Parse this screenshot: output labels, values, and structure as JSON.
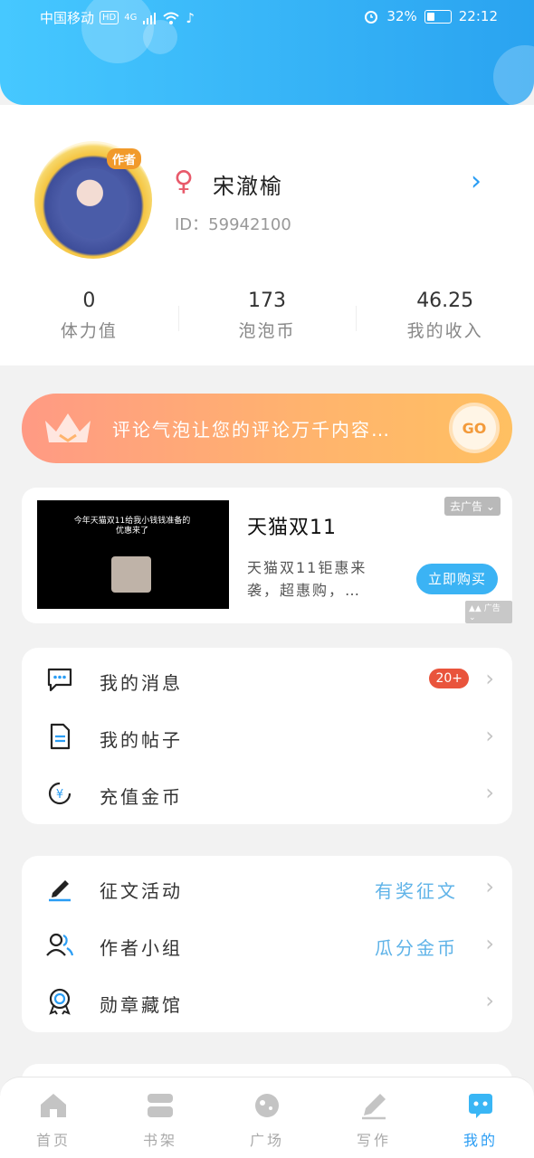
{
  "status_bar": {
    "carrier": "中国移动",
    "hd": "HD",
    "network": "4G",
    "battery_percent": "32%",
    "battery_level": 0.32,
    "time": "22:12"
  },
  "profile": {
    "author_tag": "作者",
    "username": "宋澈榆",
    "user_id": "ID：59942100",
    "stats": [
      {
        "value": "0",
        "label": "体力值"
      },
      {
        "value": "173",
        "label": "泡泡币"
      },
      {
        "value": "46.25",
        "label": "我的收入"
      }
    ]
  },
  "promo": {
    "text": "评论气泡让您的评论万千内容…",
    "button": "GO"
  },
  "ad": {
    "image_caption": "今年天猫双11给我小钱钱准备的优惠来了",
    "title": "天猫双11",
    "description": "天猫双11钜惠来袭，超惠购，…",
    "close_label": "去广告",
    "buy_label": "立即购买",
    "ad_label": "广告"
  },
  "menu_group_1": [
    {
      "label": "我的消息",
      "badge": "20+"
    },
    {
      "label": "我的帖子"
    },
    {
      "label": "充值金币"
    }
  ],
  "menu_group_2": [
    {
      "label": "征文活动",
      "extra": "有奖征文"
    },
    {
      "label": "作者小组",
      "extra": "瓜分金币"
    },
    {
      "label": "勋章藏馆"
    }
  ],
  "bottom_nav": [
    {
      "label": "首页",
      "icon": "home-icon"
    },
    {
      "label": "书架",
      "icon": "bookshelf-icon"
    },
    {
      "label": "广场",
      "icon": "planet-icon"
    },
    {
      "label": "写作",
      "icon": "pen-icon"
    },
    {
      "label": "我的",
      "icon": "mine-icon",
      "active": true
    }
  ],
  "colors": {
    "accent": "#2a9df4",
    "badge": "#e9543c",
    "highlight_text": "#5fb3e8"
  }
}
